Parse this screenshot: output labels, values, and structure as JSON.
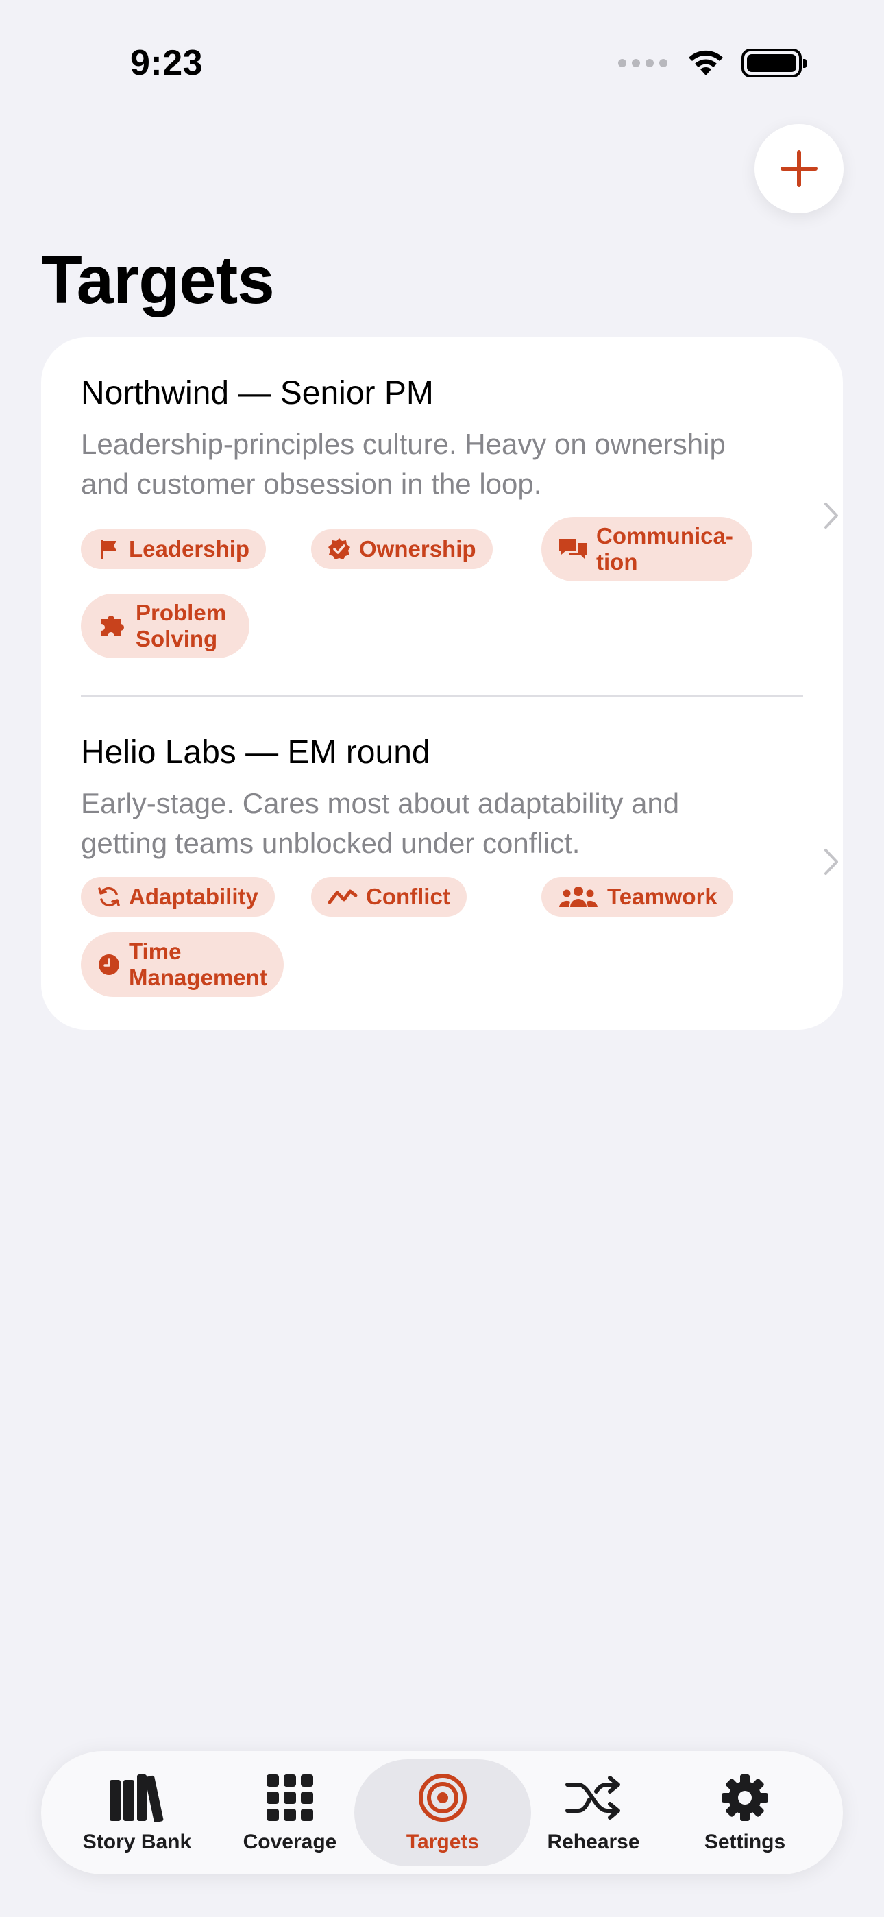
{
  "status_bar": {
    "time": "9:23"
  },
  "header": {
    "title": "Targets",
    "add_icon": "plus-icon"
  },
  "colors": {
    "accent": "#c8421c",
    "chip_bg": "#f9e1db",
    "background": "#f2f2f7"
  },
  "targets": [
    {
      "title": "Northwind — Senior PM",
      "description": "Leadership-principles culture. Heavy on ownership and customer obsession in the loop.",
      "chips": [
        {
          "label": "Leadership",
          "icon": "flag-icon"
        },
        {
          "label": "Ownership",
          "icon": "verified-badge-icon"
        },
        {
          "label": "Communica-tion",
          "icon": "speech-bubbles-icon"
        },
        {
          "label": "Problem Solving",
          "icon": "puzzle-icon"
        }
      ]
    },
    {
      "title": "Helio Labs — EM round",
      "description": "Early-stage. Cares most about adaptability and getting teams unblocked under conflict.",
      "chips": [
        {
          "label": "Adaptability",
          "icon": "refresh-icon"
        },
        {
          "label": "Conflict",
          "icon": "zigzag-icon"
        },
        {
          "label": "Teamwork",
          "icon": "people-icon"
        },
        {
          "label": "Time Management",
          "icon": "clock-icon"
        }
      ]
    }
  ],
  "tabbar": {
    "tabs": [
      {
        "label": "Story Bank",
        "icon": "books-icon"
      },
      {
        "label": "Coverage",
        "icon": "grid-icon"
      },
      {
        "label": "Targets",
        "icon": "target-icon",
        "active": true
      },
      {
        "label": "Rehearse",
        "icon": "shuffle-icon"
      },
      {
        "label": "Settings",
        "icon": "gear-icon"
      }
    ]
  }
}
